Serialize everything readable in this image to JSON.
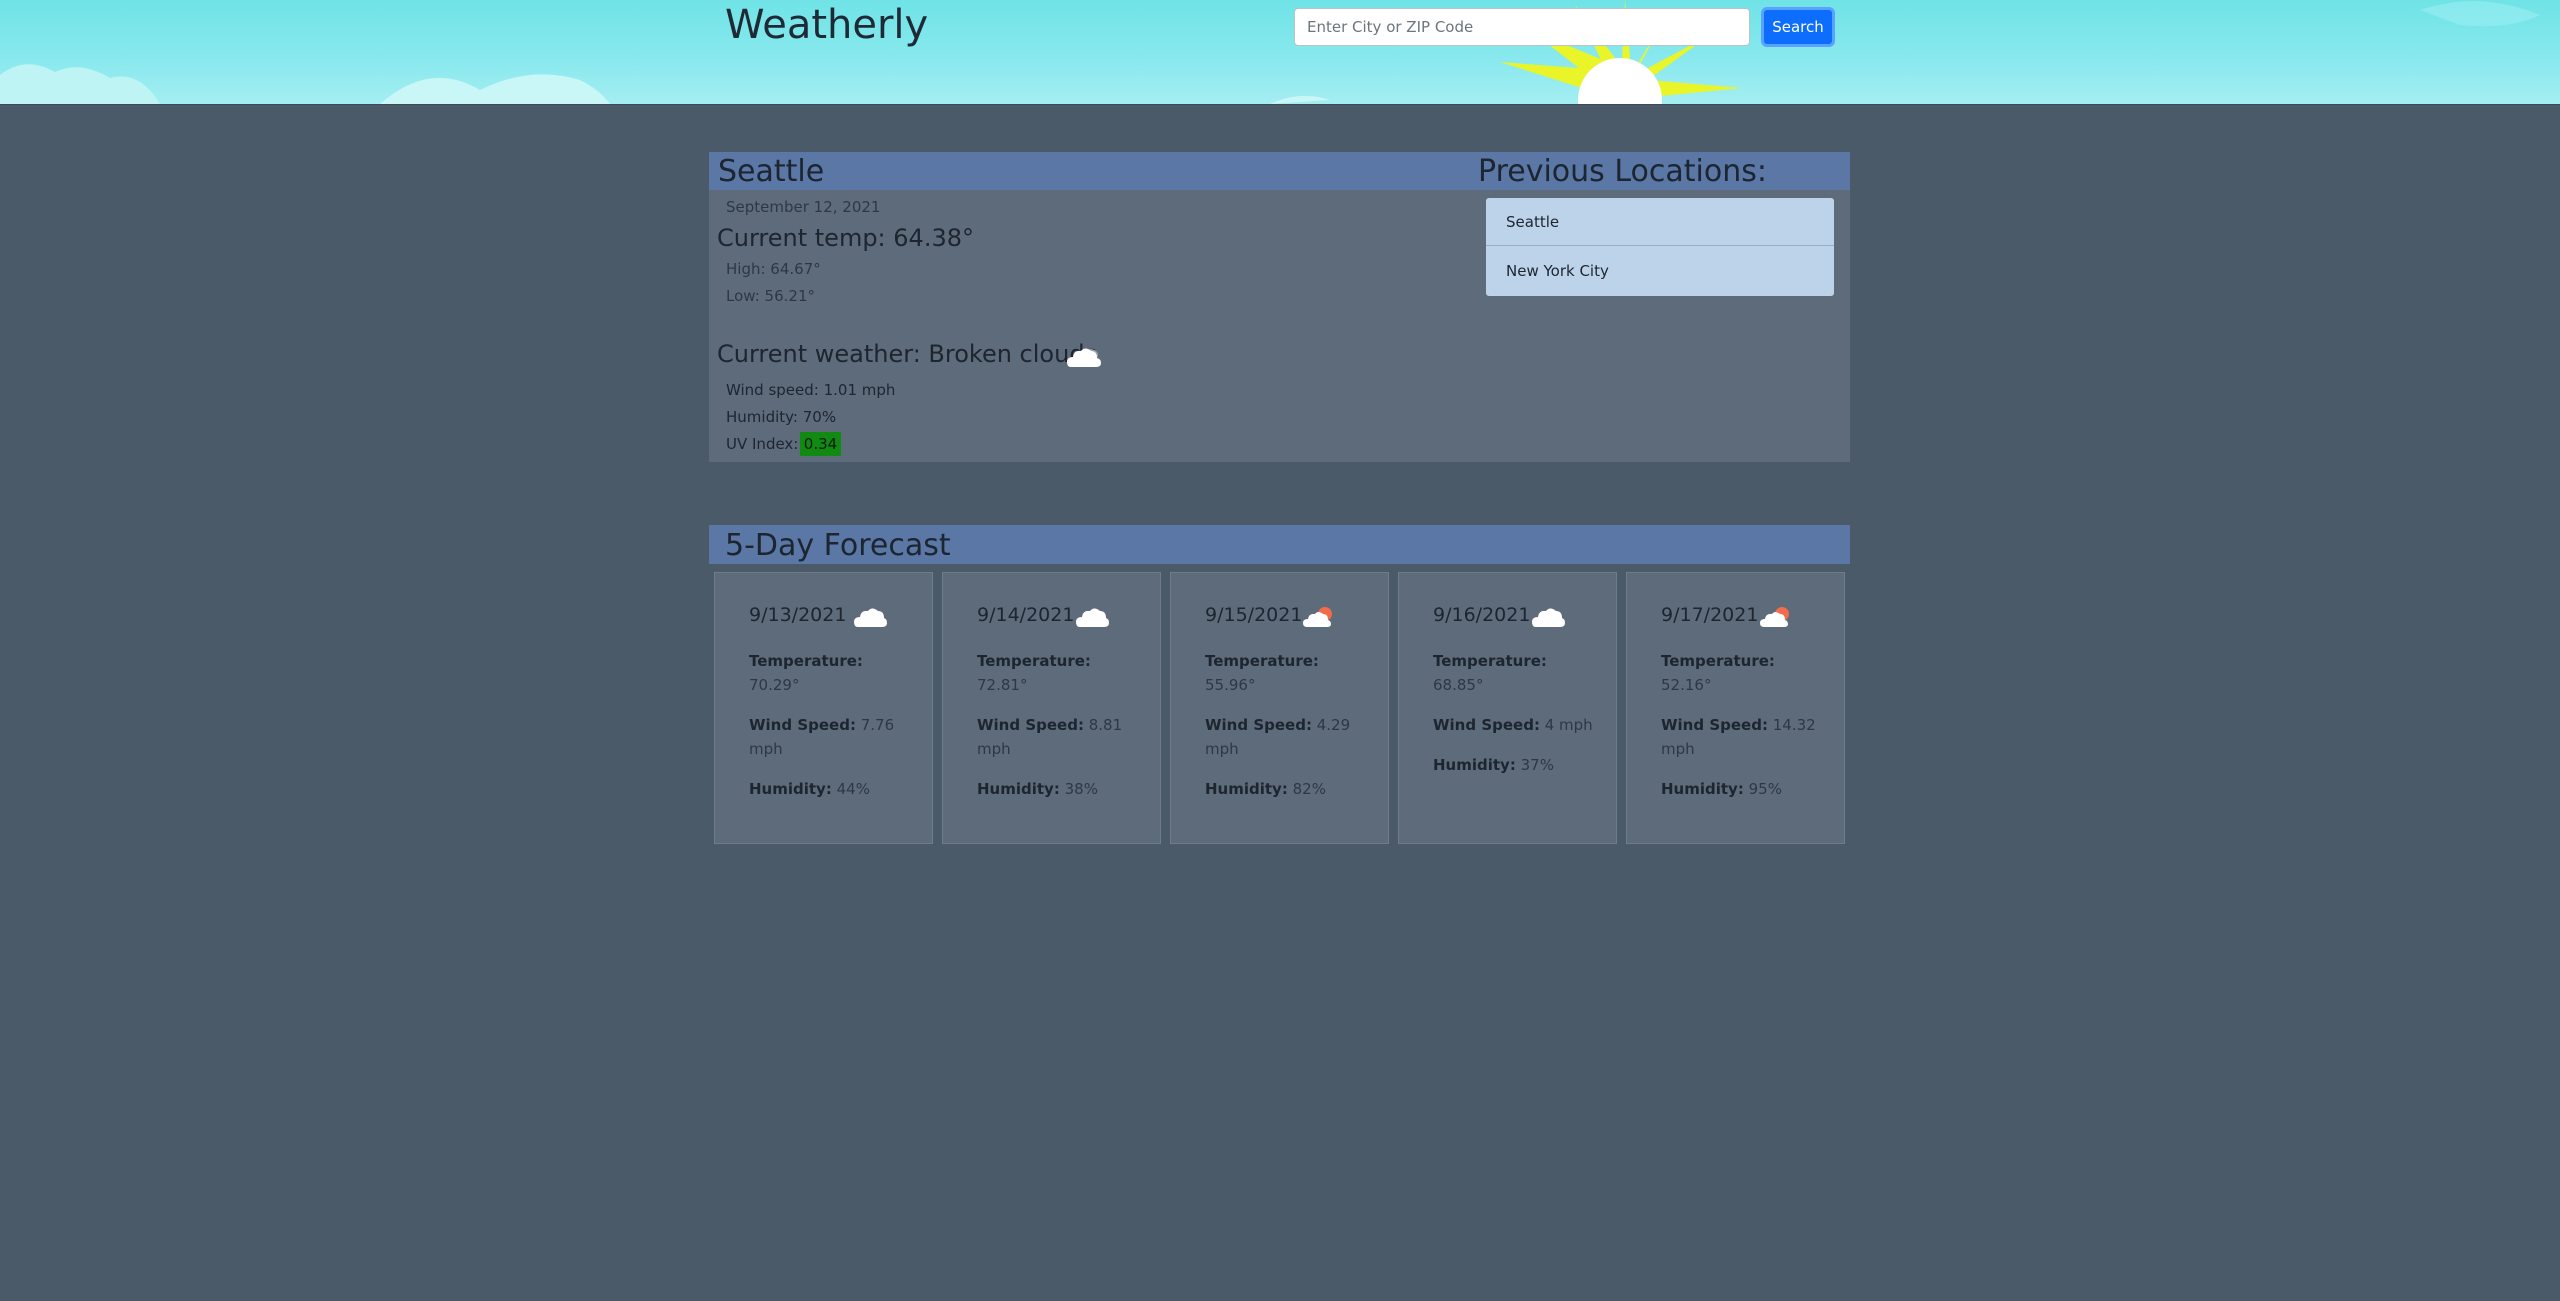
{
  "header": {
    "brand": "Weatherly",
    "search_placeholder": "Enter City or ZIP Code",
    "search_button": "Search"
  },
  "current": {
    "city": "Seattle",
    "date": "September 12, 2021",
    "temp": "Current temp: 64.38°",
    "high": "High: 64.67°",
    "low": "Low: 56.21°",
    "weather": "Current weather: Broken clouds",
    "weather_icon": "broken-clouds-icon",
    "wind": "Wind speed: 1.01 mph",
    "humidity": "Humidity: 70%",
    "uv_label": "UV Index:",
    "uv_value": "0.34",
    "uv_color": "#118a11"
  },
  "previous": {
    "title": "Previous Locations:",
    "items": [
      "Seattle",
      "New York City"
    ]
  },
  "forecast": {
    "title": "5-Day Forecast",
    "temperature_label": "Temperature:",
    "wind_label": "Wind Speed:",
    "humidity_label": "Humidity:",
    "days": [
      {
        "date": "9/13/2021",
        "icon": "cloud-icon",
        "temp": "70.29°",
        "wind": "7.76 mph",
        "humidity": "44%"
      },
      {
        "date": "9/14/2021",
        "icon": "cloud-icon",
        "temp": "72.81°",
        "wind": "8.81 mph",
        "humidity": "38%"
      },
      {
        "date": "9/15/2021",
        "icon": "sun-cloud-icon",
        "temp": "55.96°",
        "wind": "4.29 mph",
        "humidity": "82%"
      },
      {
        "date": "9/16/2021",
        "icon": "cloud-icon",
        "temp": "68.85°",
        "wind": "4 mph",
        "humidity": "37%"
      },
      {
        "date": "9/17/2021",
        "icon": "sun-cloud-icon",
        "temp": "52.16°",
        "wind": "14.32 mph",
        "humidity": "95%"
      }
    ]
  }
}
